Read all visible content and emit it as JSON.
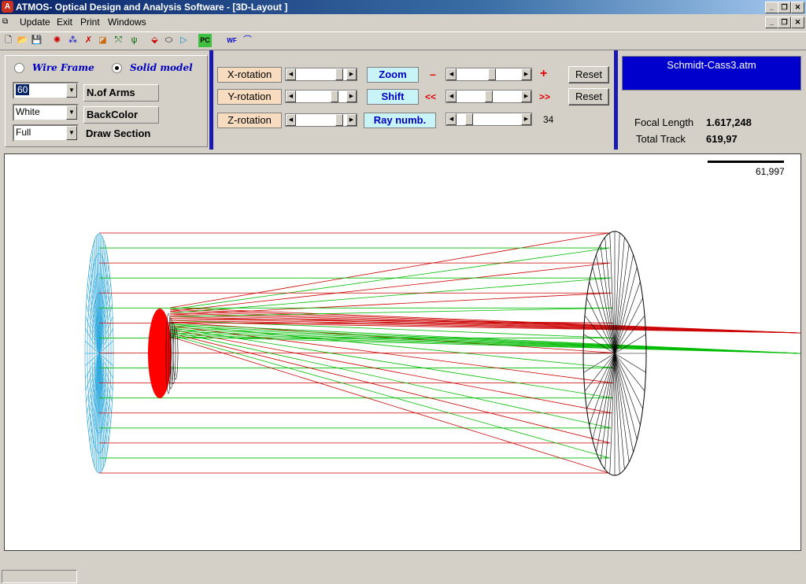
{
  "window": {
    "title": "ATMOS- Optical Design and Analysis Software - [3D-Layout ]"
  },
  "menu": [
    "Update",
    "Exit",
    "Print",
    "Windows"
  ],
  "toolbar": {
    "icons": [
      "new-file-icon",
      "open-file-icon",
      "save-icon",
      "lens-icon",
      "spot-icon",
      "mtf-icon",
      "aberration-icon",
      "psf-icon",
      "ray-fan-icon",
      "ray-icon",
      "lens-edit-icon",
      "layout-icon",
      "pc-icon",
      "wf-icon",
      "curve-icon"
    ],
    "pc_label": "PC",
    "wf_label": "WF"
  },
  "render_panel": {
    "wire_frame_label": "Wire Frame",
    "solid_model_label": "Solid model",
    "selected_mode": "Solid model",
    "arms_value": "60",
    "arms_label": "N.of Arms",
    "backcolor_value": "White",
    "backcolor_label": "BackColor",
    "section_value": "Full",
    "section_label": "Draw Section"
  },
  "controls": {
    "x_rotation_label": "X-rotation",
    "y_rotation_label": "Y-rotation",
    "z_rotation_label": "Z-rotation",
    "zoom_label": "Zoom",
    "zoom_minus": "–",
    "zoom_plus": "+",
    "shift_label": "Shift",
    "shift_left": "<<",
    "shift_right": ">>",
    "ray_numb_label": "Ray numb.",
    "ray_numb_value": "34",
    "reset_label": "Reset",
    "x_rotation_level": 0.93,
    "y_rotation_level": 0.82,
    "z_rotation_level": 0.93,
    "zoom_level": 0.55,
    "shift_level": 0.5,
    "ray_numb_level": 0.15
  },
  "info_panel": {
    "filename": "Schmidt-Cass3.atm",
    "focal_length_label": "Focal Length",
    "focal_length_value": "1.617,248",
    "total_track_label": "Total Track",
    "total_track_value": "619,97"
  },
  "layout_view": {
    "scale_value": "61,997",
    "colors": {
      "corrector": "#33aadd",
      "primary_mirror": "#000000",
      "secondary_mirror": "#ff0000",
      "ray_red": "#cc0000",
      "ray_green": "#00bb00"
    }
  },
  "colors": {
    "title_bar": "#0a246a",
    "info_panel_bg": "#0000cc",
    "divider": "#1a1ab0"
  }
}
